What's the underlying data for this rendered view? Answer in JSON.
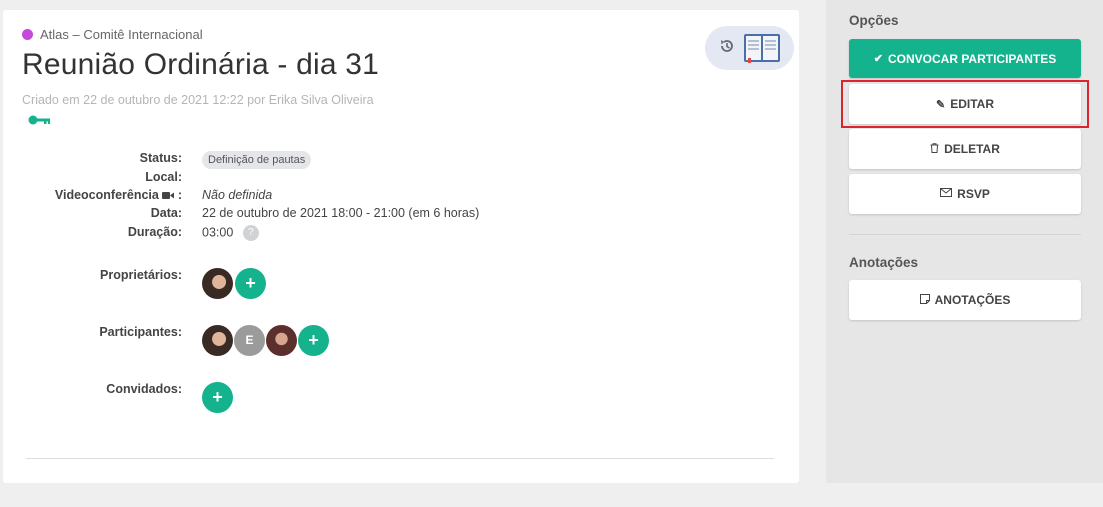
{
  "meeting": {
    "organization": "Atlas – Comitê Internacional",
    "title": "Reunião Ordinária - dia 31",
    "created": "Criado em 22 de outubro de 2021 12:22 por Erika Silva Oliveira",
    "org_color": "#c44ad8"
  },
  "fields": {
    "status_label": "Status:",
    "status_value": "Definição de pautas",
    "local_label": "Local:",
    "video_label": "Videoconferência",
    "video_suffix": ":",
    "video_value": "Não definida",
    "date_label": "Data:",
    "date_value": "22 de outubro de 2021 18:00 - 21:00 (em 6 horas)",
    "duration_label": "Duração:",
    "duration_value": "03:00",
    "help_glyph": "?"
  },
  "people": {
    "owners_label": "Proprietários:",
    "participants_label": "Participantes:",
    "guests_label": "Convidados:",
    "participant_initial": "E",
    "add_glyph": "+"
  },
  "sidebar": {
    "options_title": "Opções",
    "convocar_label": "CONVOCAR PARTICIPANTES",
    "editar_label": "EDITAR",
    "deletar_label": "DELETAR",
    "rsvp_label": "RSVP",
    "annotations_title": "Anotações",
    "annotations_label": "ANOTAÇÕES"
  },
  "colors": {
    "accent": "#14b38e",
    "highlight": "#d9262c"
  }
}
